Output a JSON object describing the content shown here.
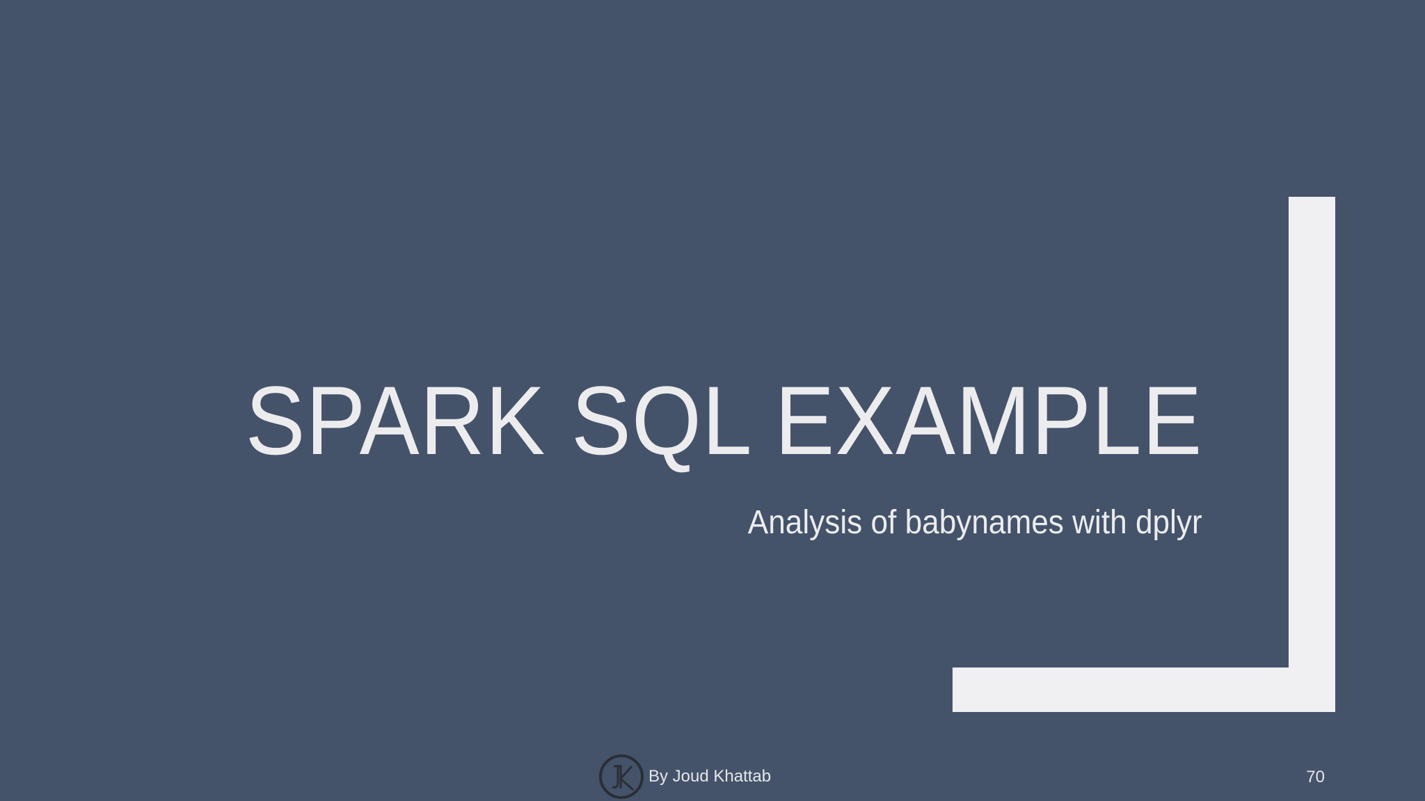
{
  "slide": {
    "title": "SPARK SQL EXAMPLE",
    "subtitle": "Analysis of babynames with dplyr",
    "footer": {
      "author_text": "By Joud Khattab",
      "logo_icon": "jk-monogram-logo",
      "logo_text": "JK"
    },
    "page_number": "70"
  },
  "colors": {
    "background": "#44536a",
    "bracket": "#f0f0f2",
    "text": "#ececee",
    "logo_stroke": "#2a2e36"
  }
}
